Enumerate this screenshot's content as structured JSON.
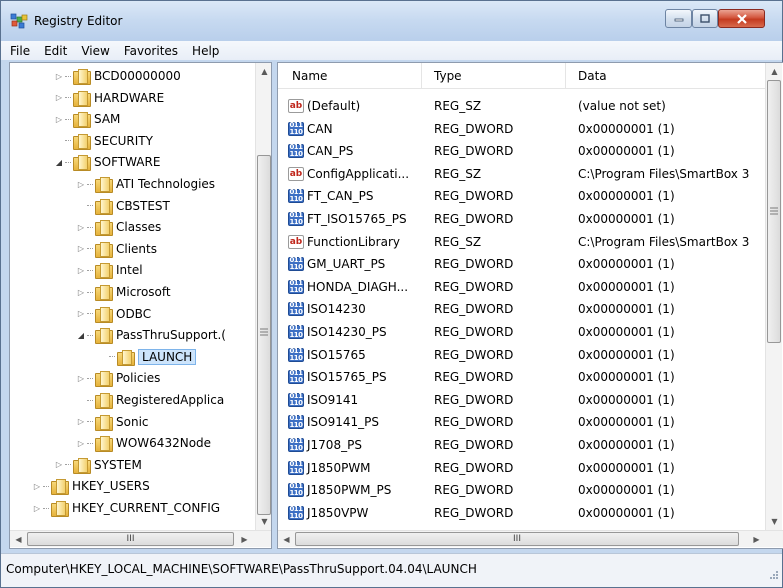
{
  "window": {
    "title": "Registry Editor"
  },
  "menu": [
    "File",
    "Edit",
    "View",
    "Favorites",
    "Help"
  ],
  "tree": [
    {
      "label": "BCD00000000",
      "expander": "closed"
    },
    {
      "label": "HARDWARE",
      "expander": "closed"
    },
    {
      "label": "SAM",
      "expander": "closed"
    },
    {
      "label": "SECURITY",
      "expander": "none"
    },
    {
      "label": "SOFTWARE",
      "expander": "open"
    },
    {
      "label": "ATI Technologies",
      "expander": "closed"
    },
    {
      "label": "CBSTEST",
      "expander": "none"
    },
    {
      "label": "Classes",
      "expander": "closed"
    },
    {
      "label": "Clients",
      "expander": "closed"
    },
    {
      "label": "Intel",
      "expander": "closed"
    },
    {
      "label": "Microsoft",
      "expander": "closed"
    },
    {
      "label": "ODBC",
      "expander": "closed"
    },
    {
      "label": "PassThruSupport.(",
      "expander": "open"
    },
    {
      "label": "LAUNCH",
      "expander": "none",
      "selected": true
    },
    {
      "label": "Policies",
      "expander": "closed"
    },
    {
      "label": "RegisteredApplica",
      "expander": "none"
    },
    {
      "label": "Sonic",
      "expander": "closed"
    },
    {
      "label": "WOW6432Node",
      "expander": "closed"
    },
    {
      "label": "SYSTEM",
      "expander": "closed"
    },
    {
      "label": "HKEY_USERS",
      "expander": "closed"
    },
    {
      "label": "HKEY_CURRENT_CONFIG",
      "expander": "closed"
    }
  ],
  "columns": {
    "name": "Name",
    "type": "Type",
    "data": "Data"
  },
  "values": [
    {
      "name": "(Default)",
      "type": "REG_SZ",
      "data": "(value not set)",
      "icon": "ab"
    },
    {
      "name": "CAN",
      "type": "REG_DWORD",
      "data": "0x00000001 (1)",
      "icon": "dword"
    },
    {
      "name": "CAN_PS",
      "type": "REG_DWORD",
      "data": "0x00000001 (1)",
      "icon": "dword"
    },
    {
      "name": "ConfigApplicati...",
      "type": "REG_SZ",
      "data": "C:\\Program Files\\SmartBox 3",
      "icon": "ab"
    },
    {
      "name": "FT_CAN_PS",
      "type": "REG_DWORD",
      "data": "0x00000001 (1)",
      "icon": "dword"
    },
    {
      "name": "FT_ISO15765_PS",
      "type": "REG_DWORD",
      "data": "0x00000001 (1)",
      "icon": "dword"
    },
    {
      "name": "FunctionLibrary",
      "type": "REG_SZ",
      "data": "C:\\Program Files\\SmartBox 3",
      "icon": "ab"
    },
    {
      "name": "GM_UART_PS",
      "type": "REG_DWORD",
      "data": "0x00000001 (1)",
      "icon": "dword"
    },
    {
      "name": "HONDA_DIAGH...",
      "type": "REG_DWORD",
      "data": "0x00000001 (1)",
      "icon": "dword"
    },
    {
      "name": "ISO14230",
      "type": "REG_DWORD",
      "data": "0x00000001 (1)",
      "icon": "dword"
    },
    {
      "name": "ISO14230_PS",
      "type": "REG_DWORD",
      "data": "0x00000001 (1)",
      "icon": "dword"
    },
    {
      "name": "ISO15765",
      "type": "REG_DWORD",
      "data": "0x00000001 (1)",
      "icon": "dword"
    },
    {
      "name": "ISO15765_PS",
      "type": "REG_DWORD",
      "data": "0x00000001 (1)",
      "icon": "dword"
    },
    {
      "name": "ISO9141",
      "type": "REG_DWORD",
      "data": "0x00000001 (1)",
      "icon": "dword"
    },
    {
      "name": "ISO9141_PS",
      "type": "REG_DWORD",
      "data": "0x00000001 (1)",
      "icon": "dword"
    },
    {
      "name": "J1708_PS",
      "type": "REG_DWORD",
      "data": "0x00000001 (1)",
      "icon": "dword"
    },
    {
      "name": "J1850PWM",
      "type": "REG_DWORD",
      "data": "0x00000001 (1)",
      "icon": "dword"
    },
    {
      "name": "J1850PWM_PS",
      "type": "REG_DWORD",
      "data": "0x00000001 (1)",
      "icon": "dword"
    },
    {
      "name": "J1850VPW",
      "type": "REG_DWORD",
      "data": "0x00000001 (1)",
      "icon": "dword"
    }
  ],
  "status": {
    "path": "Computer\\HKEY_LOCAL_MACHINE\\SOFTWARE\\PassThruSupport.04.04\\LAUNCH"
  },
  "icons": {
    "app": "registry-editor-icon",
    "string_value": "ab",
    "dword_value": "011\n110",
    "hscroll_thumb": "III"
  },
  "colors": {
    "selection": "#cde4fb",
    "close_button": "#c43b20",
    "titlebar": "#c6d9f0"
  }
}
